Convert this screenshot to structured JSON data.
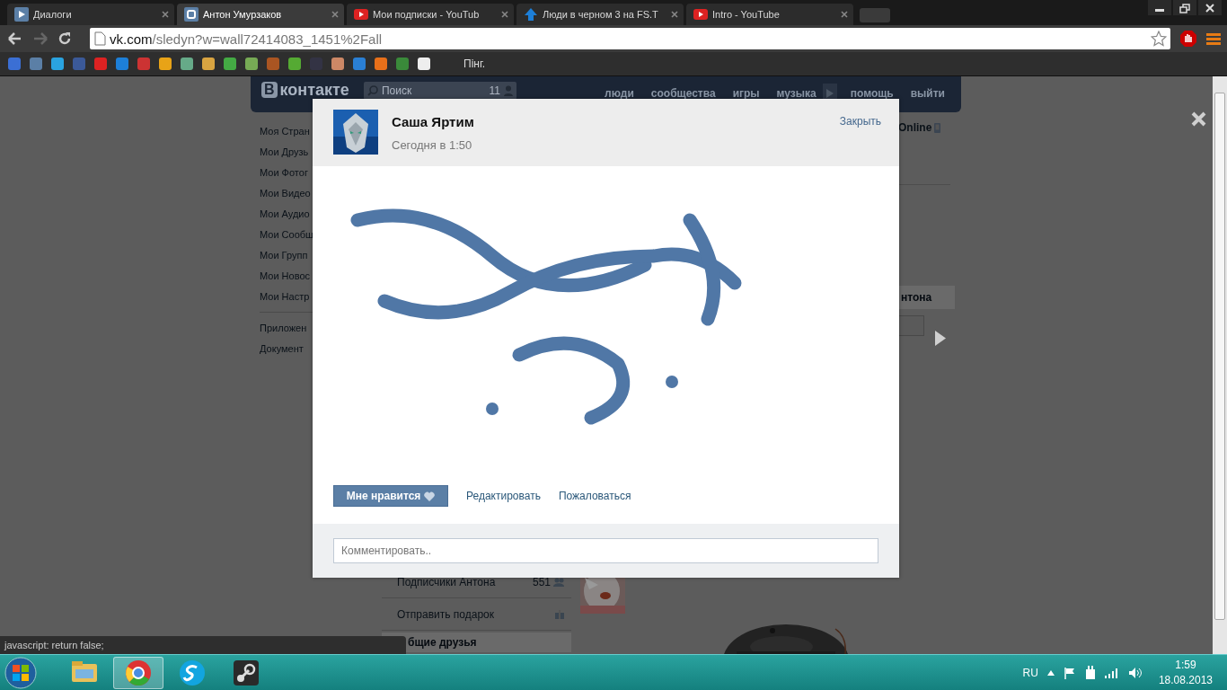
{
  "browser": {
    "tabs": [
      {
        "title": "Диалоги",
        "kind": "dialogs",
        "selected": false
      },
      {
        "title": "Антон Умурзаков",
        "kind": "vk",
        "selected": true
      },
      {
        "title": "Мои подписки - YouTub",
        "kind": "youtube",
        "selected": false
      },
      {
        "title": "Люди в черном 3 на FS.T",
        "kind": "arrow",
        "selected": false
      },
      {
        "title": "Intro - YouTube",
        "kind": "youtube",
        "selected": false
      }
    ],
    "address": {
      "host": "vk.com",
      "path": "/sledyn?w=wall72414083_1451%2Fall"
    },
    "bookmark": "Пінг."
  },
  "page": {
    "header": {
      "logo_letter": "В",
      "logo": "контакте",
      "search_placeholder": "Поиск",
      "search_count": "11",
      "nav": [
        "люди",
        "сообщества",
        "игры",
        "музыка",
        "помощь",
        "выйти"
      ]
    },
    "menu": [
      {
        "label": "Моя Стран"
      },
      {
        "label": "Мои Друзь"
      },
      {
        "label": "Мои Фотог"
      },
      {
        "label": "Мои Видео"
      },
      {
        "label": "Мои Аудио"
      },
      {
        "label": "Мои Сообщ"
      },
      {
        "label": "Мои Групп"
      },
      {
        "label": "Мои Новос"
      },
      {
        "label": "Мои Настр"
      },
      {
        "label": "Приложен",
        "divider": true
      },
      {
        "label": "Документ"
      }
    ],
    "profile_links": [
      {
        "label": "Подписчики Антона",
        "count": "551",
        "kind": "followers"
      },
      {
        "label": "Отправить подарок",
        "kind": "gift"
      }
    ],
    "friends_heading": "бщие друзья",
    "online": "Online",
    "side_heading": "нтона"
  },
  "post": {
    "author": "Саша Яртим",
    "date": "Сегодня в 1:50",
    "close": "Закрыть",
    "like": "Мне нравится",
    "actions": [
      "Редактировать",
      "Пожаловаться"
    ],
    "comment_placeholder": "Комментировать.."
  },
  "status_tooltip": "javascript: return false;",
  "taskbar": {
    "apps": [
      {
        "kind": "folder",
        "selected": false
      },
      {
        "kind": "chrome",
        "selected": true
      },
      {
        "kind": "skype",
        "selected": false
      },
      {
        "kind": "steam",
        "selected": false
      }
    ],
    "language": "RU",
    "time": "1:59",
    "date": "18.08.2013"
  }
}
